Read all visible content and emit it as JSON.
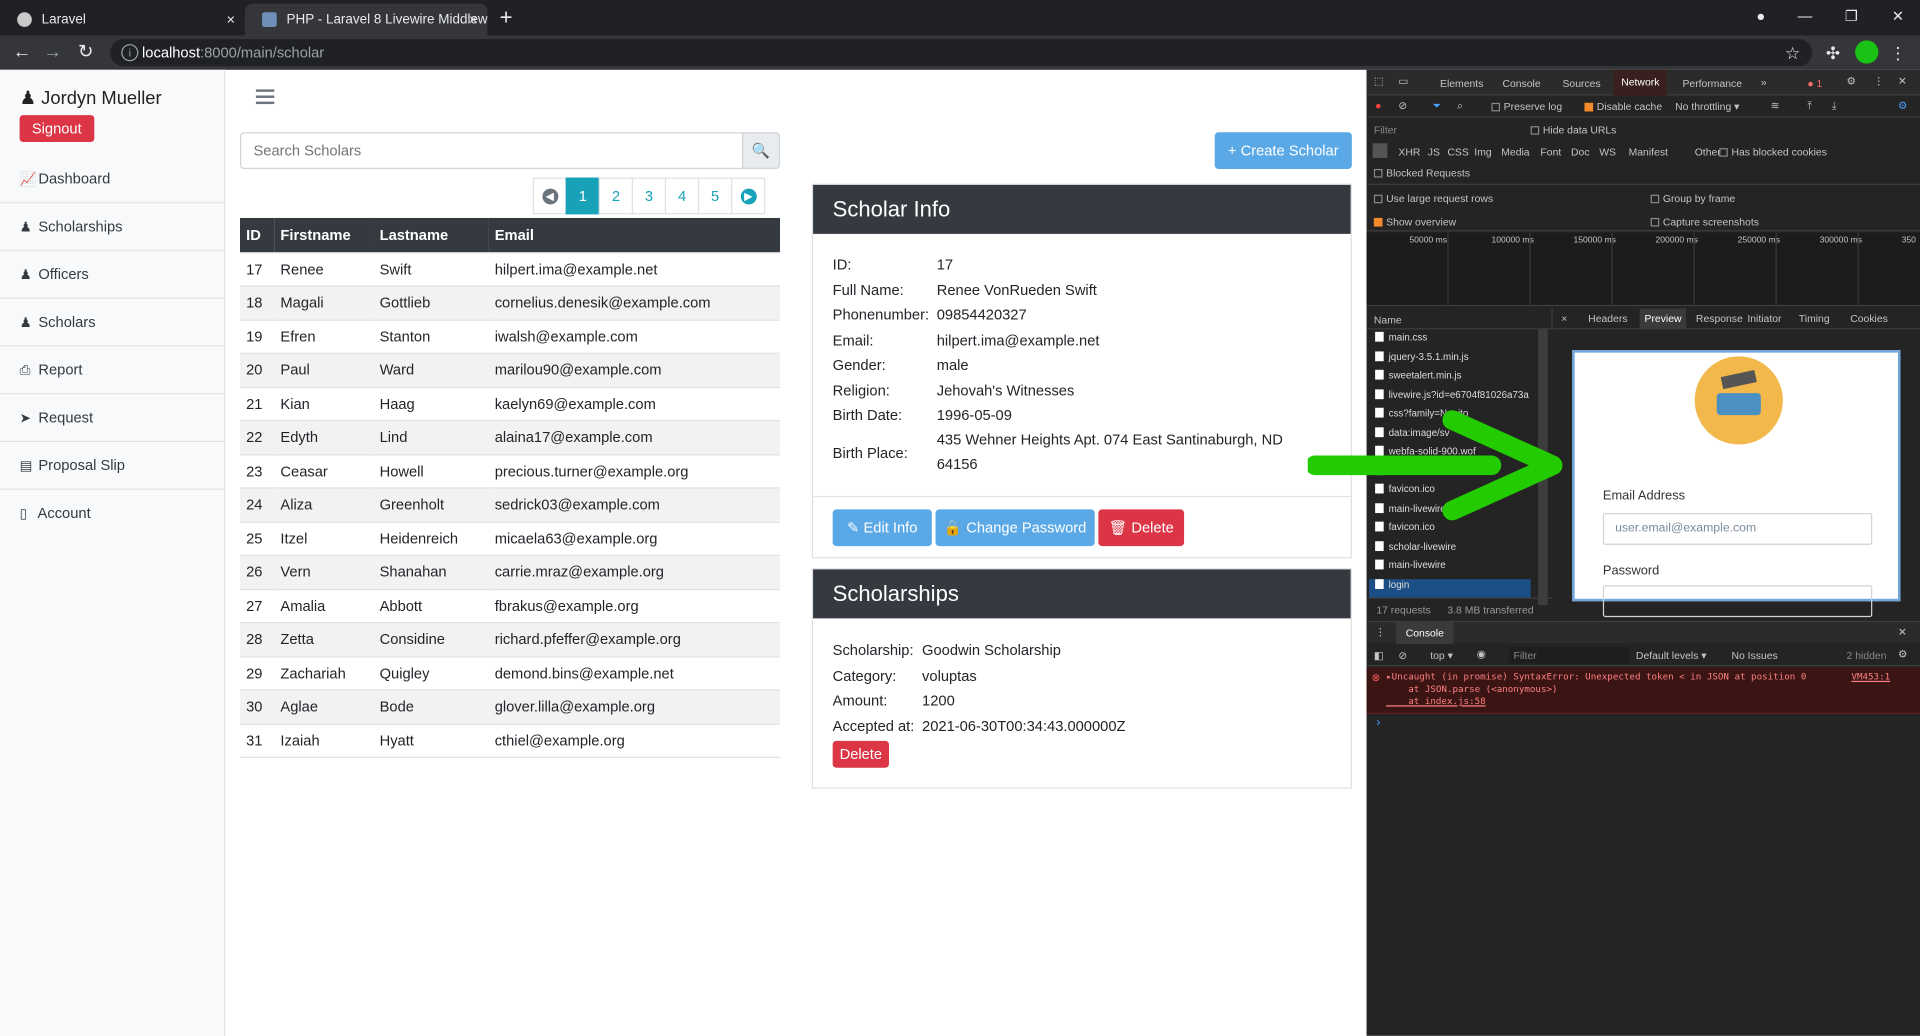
{
  "browser": {
    "tabs": [
      {
        "title": "Laravel",
        "close": "×"
      },
      {
        "title": "PHP - Laravel 8 Livewire Middlew",
        "close": "×"
      }
    ],
    "new_tab": "+",
    "url_host": "localhost",
    "url_path": ":8000/main/scholar"
  },
  "app": {
    "user_name": "Jordyn Mueller",
    "signout_label": "Signout",
    "nav": [
      {
        "label": "Dashboard",
        "icon": "chart-icon"
      },
      {
        "label": "Scholarships",
        "icon": "user-icon"
      },
      {
        "label": "Officers",
        "icon": "user-icon"
      },
      {
        "label": "Scholars",
        "icon": "user-icon"
      },
      {
        "label": "Report",
        "icon": "print-icon"
      },
      {
        "label": "Request",
        "icon": "send-icon"
      },
      {
        "label": "Proposal Slip",
        "icon": "file-icon"
      },
      {
        "label": "Account",
        "icon": "mobile-icon"
      }
    ],
    "search_placeholder": "Search Scholars",
    "create_label": "+ Create Scholar",
    "pages": [
      "1",
      "2",
      "3",
      "4",
      "5"
    ],
    "table": {
      "headers": [
        "ID",
        "Firstname",
        "Lastname",
        "Email"
      ],
      "rows": [
        [
          "17",
          "Renee",
          "Swift",
          "hilpert.ima@example.net"
        ],
        [
          "18",
          "Magali",
          "Gottlieb",
          "cornelius.denesik@example.com"
        ],
        [
          "19",
          "Efren",
          "Stanton",
          "iwalsh@example.com"
        ],
        [
          "20",
          "Paul",
          "Ward",
          "marilou90@example.com"
        ],
        [
          "21",
          "Kian",
          "Haag",
          "kaelyn69@example.com"
        ],
        [
          "22",
          "Edyth",
          "Lind",
          "alaina17@example.com"
        ],
        [
          "23",
          "Ceasar",
          "Howell",
          "precious.turner@example.org"
        ],
        [
          "24",
          "Aliza",
          "Greenholt",
          "sedrick03@example.com"
        ],
        [
          "25",
          "Itzel",
          "Heidenreich",
          "micaela63@example.org"
        ],
        [
          "26",
          "Vern",
          "Shanahan",
          "carrie.mraz@example.org"
        ],
        [
          "27",
          "Amalia",
          "Abbott",
          "fbrakus@example.org"
        ],
        [
          "28",
          "Zetta",
          "Considine",
          "richard.pfeffer@example.org"
        ],
        [
          "29",
          "Zachariah",
          "Quigley",
          "demond.bins@example.net"
        ],
        [
          "30",
          "Aglae",
          "Bode",
          "glover.lilla@example.org"
        ],
        [
          "31",
          "Izaiah",
          "Hyatt",
          "cthiel@example.org"
        ]
      ]
    },
    "scholar_info": {
      "title": "Scholar Info",
      "fields": [
        {
          "k": "ID:",
          "v": "17"
        },
        {
          "k": "Full Name:",
          "v": "Renee VonRueden Swift"
        },
        {
          "k": "Phonenumber:",
          "v": "09854420327"
        },
        {
          "k": "Email:",
          "v": "hilpert.ima@example.net"
        },
        {
          "k": "Gender:",
          "v": "male"
        },
        {
          "k": "Religion:",
          "v": "Jehovah's Witnesses"
        },
        {
          "k": "Birth Date:",
          "v": "1996-05-09"
        },
        {
          "k": "Birth Place:",
          "v": "435 Wehner Heights Apt. 074 East Santinaburgh, ND",
          "v2": "64156"
        }
      ],
      "edit_label": "Edit Info",
      "password_label": "Change Password",
      "delete_label": "Delete"
    },
    "scholarships": {
      "title": "Scholarships",
      "fields": [
        {
          "k": "Scholarship:",
          "v": "Goodwin Scholarship"
        },
        {
          "k": "Category:",
          "v": "voluptas"
        },
        {
          "k": "Amount:",
          "v": "1200"
        },
        {
          "k": "Accepted at:",
          "v": "2021-06-30T00:34:43.000000Z"
        }
      ],
      "delete_label": "Delete"
    }
  },
  "devtools": {
    "tabs": [
      "Elements",
      "Console",
      "Sources",
      "Network",
      "Performance",
      "»"
    ],
    "error_count": "1",
    "toolbar": {
      "preserve_log": "Preserve log",
      "disable_cache": "Disable cache",
      "throttling": "No throttling"
    },
    "filter_placeholder": "Filter",
    "hide_data_urls": "Hide data URLs",
    "types": [
      "XHR",
      "JS",
      "CSS",
      "Img",
      "Media",
      "Font",
      "Doc",
      "WS",
      "Manifest",
      "Other"
    ],
    "blocked_cookies": "Has blocked cookies",
    "blocked_requests": "Blocked Requests",
    "large_rows": "Use large request rows",
    "group_by_frame": "Group by frame",
    "show_overview": "Show overview",
    "capture_screenshots": "Capture screenshots",
    "timeline_ticks": [
      "50000 ms",
      "100000 ms",
      "150000 ms",
      "200000 ms",
      "250000 ms",
      "300000 ms",
      "350"
    ],
    "name_header": "Name",
    "detail_tabs": [
      "Headers",
      "Preview",
      "Response",
      "Initiator",
      "Timing",
      "Cookies"
    ],
    "files": [
      "main.css",
      "jquery-3.5.1.min.js",
      "sweetalert.min.js",
      "livewire.js?id=e6704f81026a73a",
      "css?family=Nunito",
      "data:image/sv",
      "webfa-solid-900.wof",
      "",
      "favicon.ico",
      "main-livewire",
      "favicon.ico",
      "scholar-livewire",
      "main-livewire",
      "login"
    ],
    "summary": "17 requests",
    "transferred": "3.8 MB transferred",
    "preview": {
      "email_label": "Email Address",
      "email_placeholder": "user.email@example.com",
      "password_label": "Password"
    },
    "console": {
      "tab": "Console",
      "context": "top",
      "filter": "Filter",
      "levels": "Default levels",
      "issues": "No Issues",
      "hidden": "2 hidden",
      "error_line1": "▸Uncaught (in promise) SyntaxError: Unexpected token < in JSON at position 0",
      "error_line2": "    at JSON.parse (<anonymous>)",
      "error_line3": "    at index.js:58",
      "error_src": "VM453:1",
      "prompt": "›"
    }
  },
  "colors": {
    "accent": "#17a2b8",
    "danger": "#dc3545",
    "dark": "#343a40",
    "arrow": "#22cc00"
  }
}
